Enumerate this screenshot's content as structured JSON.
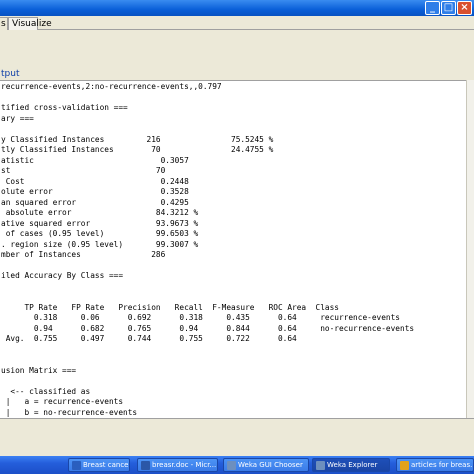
{
  "window": {
    "buttons": [
      "_",
      "□",
      "×"
    ]
  },
  "tabs": [
    {
      "label": "s"
    },
    {
      "label": "Visualize"
    }
  ],
  "panel": {
    "title": "tput"
  },
  "output_lines": [
    "recurrence-events,2:no-recurrence-events,,0.797",
    "",
    "tified cross-validation ===",
    "ary ===",
    "",
    "y Classified Instances         216               75.5245 %",
    "tly Classified Instances        70               24.4755 %",
    "atistic                           0.3057",
    "st                               70",
    " Cost                             0.2448",
    "olute error                       0.3528",
    "an squared error                  0.4295",
    " absolute error                  84.3212 %",
    "ative squared error              93.9673 %",
    " of cases (0.95 level)           99.6503 %",
    ". region size (0.95 level)       99.3007 %",
    "mber of Instances               286",
    "",
    "iled Accuracy By Class ===",
    "",
    "",
    "     TP Rate   FP Rate   Precision   Recall  F-Measure   ROC Area  Class",
    "       0.318     0.06      0.692      0.318     0.435      0.64     recurrence-events",
    "       0.94      0.682     0.765      0.94      0.844      0.64     no-recurrence-events",
    " Avg.  0.755     0.497     0.744      0.755     0.722      0.64",
    "",
    "",
    "usion Matrix ===",
    "",
    "  <-- classified as",
    " |   a = recurrence-events",
    " |   b = no-recurrence-events"
  ],
  "taskbar": [
    {
      "label": "Breast cancer oc...",
      "icon_color": "#2a5fbf"
    },
    {
      "label": "breasr.doc - Micr...",
      "icon_color": "#2b57a8"
    },
    {
      "label": "Weka GUI Chooser",
      "icon_color": "#6d8fbe"
    },
    {
      "label": "Weka Explorer",
      "icon_color": "#6d8fbe"
    },
    {
      "label": "articles for breas...",
      "icon_color": "#e3a21a"
    }
  ]
}
